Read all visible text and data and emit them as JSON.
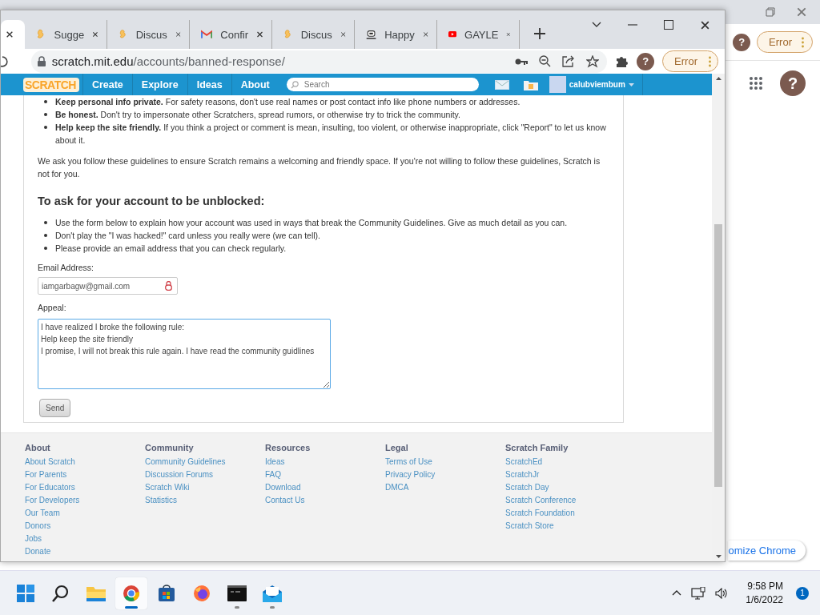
{
  "background_window": {
    "profile_avatar": "?",
    "profile_button": "Error",
    "apps_avatar": "?",
    "customize_button": "omize Chrome"
  },
  "browser": {
    "tabs": [
      {
        "kind": "blank",
        "selected": true
      },
      {
        "title": "Sugge",
        "kind": "scratch",
        "selected": false
      },
      {
        "title": "Discus",
        "kind": "scratch",
        "selected": false
      },
      {
        "title": "Confir",
        "kind": "gmail",
        "selected": false
      },
      {
        "title": "Discus",
        "kind": "scratch",
        "selected": false
      },
      {
        "title": "Happy",
        "kind": "robot",
        "selected": false
      },
      {
        "title": "GAYLE",
        "kind": "youtube",
        "selected": false
      }
    ],
    "address": {
      "host": "scratch.mit.edu",
      "path": "/accounts/banned-response/"
    },
    "profile_avatar": "?",
    "profile_button": "Error"
  },
  "scratch": {
    "nav": {
      "logo": "SCRATCH",
      "links": [
        "Create",
        "Explore",
        "Ideas",
        "About"
      ],
      "search_placeholder": "Search",
      "username": "calubviembum"
    },
    "guidelines": [
      "**Keep personal info private.** For safety reasons, don't use real names or post contact info like phone numbers or addresses.",
      "**Be honest.** Don't try to impersonate other Scratchers, spread rumors, or otherwise try to trick the community.",
      "**Help keep the site friendly.** If you think a project or comment is mean, insulting, too violent, or otherwise inappropriate, click \"Report\" to let us know about it."
    ],
    "closing_paragraph": "We ask you follow these guidelines to ensure Scratch remains a welcoming and friendly space. If you're not willing to follow these guidelines, Scratch is not for you.",
    "unblock_heading": "To ask for your account to be unblocked:",
    "unblock_steps": [
      "Use the form below to explain how your account was used in ways that break the Community Guidelines. Give as much detail as you can.",
      "Don't play the \"I was hacked!\" card unless you really were (we can tell).",
      "Please provide an email address that you can check regularly."
    ],
    "form": {
      "email_label": "Email Address:",
      "email_value": "iamgarbagw@gmail.com",
      "appeal_label": "Appeal:",
      "appeal_value": "I have realized I broke the following rule:\nHelp keep the site friendly\nI promise, I will not break this rule again. I have read the community guidlines",
      "send_button": "Send"
    },
    "footer": [
      {
        "heading": "About",
        "links": [
          "About Scratch",
          "For Parents",
          "For Educators",
          "For Developers",
          "Our Team",
          "Donors",
          "Jobs",
          "Donate"
        ]
      },
      {
        "heading": "Community",
        "links": [
          "Community Guidelines",
          "Discussion Forums",
          "Scratch Wiki",
          "Statistics"
        ]
      },
      {
        "heading": "Resources",
        "links": [
          "Ideas",
          "FAQ",
          "Download",
          "Contact Us"
        ]
      },
      {
        "heading": "Legal",
        "links": [
          "Terms of Use",
          "Privacy Policy",
          "DMCA"
        ]
      },
      {
        "heading": "Scratch Family",
        "links": [
          "ScratchEd",
          "ScratchJr",
          "Scratch Day",
          "Scratch Conference",
          "Scratch Foundation",
          "Scratch Store"
        ]
      }
    ]
  },
  "taskbar": {
    "apps": [
      {
        "kind": "start",
        "selected": false,
        "running": false
      },
      {
        "kind": "search",
        "selected": false,
        "running": false
      },
      {
        "kind": "folder",
        "selected": false,
        "running": false
      },
      {
        "kind": "chrome",
        "selected": true,
        "running": true
      },
      {
        "kind": "store",
        "selected": false,
        "running": false
      },
      {
        "kind": "firefox",
        "selected": false,
        "running": false
      },
      {
        "kind": "terminal",
        "selected": false,
        "running": true
      },
      {
        "kind": "mail",
        "selected": false,
        "running": true
      }
    ],
    "time": "9:58 PM",
    "date": "1/6/2022",
    "notification_count": "1"
  }
}
